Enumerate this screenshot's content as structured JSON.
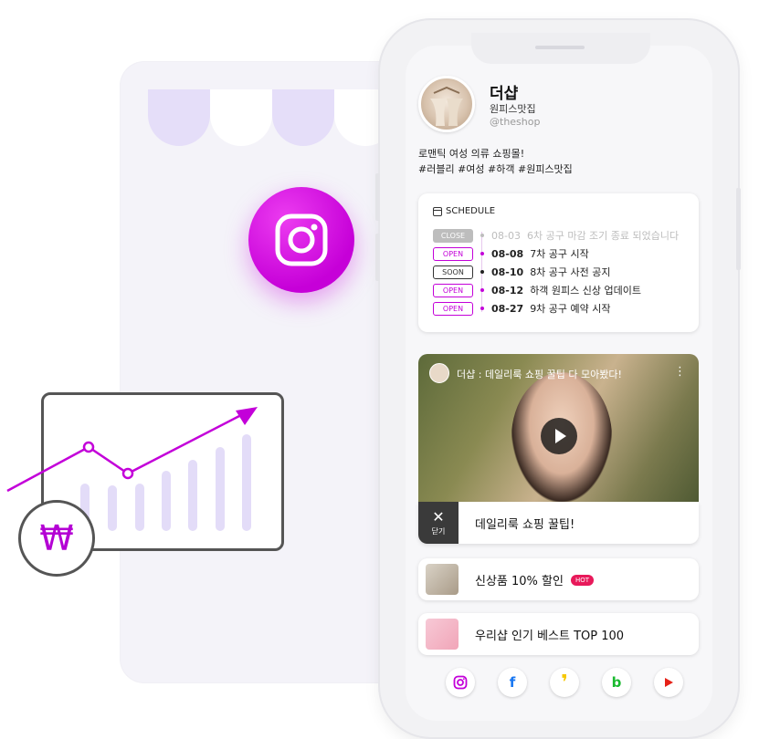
{
  "profile": {
    "name": "더샵",
    "category": "원피스맛집",
    "handle": "@theshop",
    "bio_line1": "로맨틱 여성 의류 쇼핑몰!",
    "bio_line2": "#러블리 #여성 #하객 #원피스맛집"
  },
  "schedule": {
    "title": "SCHEDULE",
    "items": [
      {
        "badge": "CLOSE",
        "date": "08-03",
        "text": "6차 공구 마감 조기 종료 되었습니다"
      },
      {
        "badge": "OPEN",
        "date": "08-08",
        "text": "7차 공구 시작"
      },
      {
        "badge": "SOON",
        "date": "08-10",
        "text": "8차 공구 사전 공지"
      },
      {
        "badge": "OPEN",
        "date": "08-12",
        "text": "하객 원피스 신상 업데이트"
      },
      {
        "badge": "OPEN",
        "date": "08-27",
        "text": "9차 공구 예약 시작"
      }
    ]
  },
  "video": {
    "title": "더샵 : 데일리룩 쇼핑 꿀팁 다 모아봤다!",
    "more": "⋮",
    "close_icon": "✕",
    "close_label": "닫기",
    "caption": "데일리룩 쇼핑 꿀팁!"
  },
  "links": [
    {
      "label": "신상품 10% 할인",
      "badge": "HOT"
    },
    {
      "label": "우리샵 인기 베스트 TOP 100"
    }
  ],
  "socials": {
    "facebook": "f",
    "kakao": "❜",
    "blog": "b"
  },
  "currency_symbol": "₩",
  "colors": {
    "accent": "#c300d9",
    "hot": "#e8195a",
    "awning_purple": "#e5def9",
    "chart_line": "#c300d9",
    "chart_bars": "#e3dcf8"
  },
  "icons": {
    "feature": "instagram-icon",
    "schedule": "calendar-icon",
    "socials": [
      "instagram-icon",
      "facebook-icon",
      "kakao-icon",
      "blog-icon",
      "youtube-icon"
    ]
  }
}
